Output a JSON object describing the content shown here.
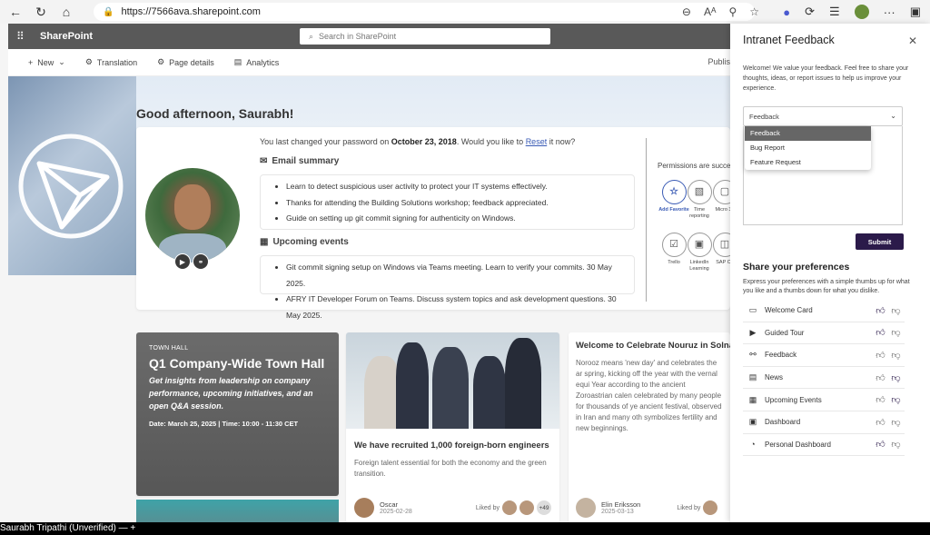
{
  "browser": {
    "url": "https://7566ava.sharepoint.com"
  },
  "sharepoint": {
    "brand": "SharePoint",
    "search_placeholder": "Search in SharePoint",
    "commands": {
      "new": "New",
      "translation": "Translation",
      "page_details": "Page details",
      "analytics": "Analytics",
      "publish": "Publis"
    }
  },
  "welcome": {
    "greeting": "Good afternoon, Saurabh!",
    "pw_prefix": "You last changed your password on ",
    "pw_date": "October 23, 2018",
    "pw_middle": ". Would you like to ",
    "pw_link": "Reset",
    "pw_suffix": " it now?",
    "email_title": "Email summary",
    "emails": [
      "Learn to detect suspicious user activity to protect your IT systems effectively.",
      "Thanks for attending the Building Solutions workshop; feedback appreciated.",
      "Guide on setting up git commit signing for authenticity on Windows."
    ],
    "events_title": "Upcoming events",
    "events": [
      "Git commit signing setup on Windows via Teams meeting. Learn to verify your commits. 30 May 2025.",
      "AFRY IT Developer Forum on Teams. Discuss system topics and ask development questions. 30 May 2025."
    ],
    "permissions_text": "Permissions are succes",
    "apps": [
      {
        "label": "Add Favorite",
        "icon": "star-plus-icon"
      },
      {
        "label": "Time reporting",
        "icon": "timesheet-icon"
      },
      {
        "label": "Micro 36",
        "icon": "microsoft-icon"
      },
      {
        "label": "Trello",
        "icon": "checkbox-icon"
      },
      {
        "label": "LinkedIn Learning",
        "icon": "learning-icon"
      },
      {
        "label": "SAP Co",
        "icon": "sap-icon"
      }
    ]
  },
  "news": {
    "town_hall": {
      "tag": "TOWN HALL",
      "title": "Q1 Company-Wide Town Hall",
      "subtitle": "Get insights from leadership on company performance, upcoming initiatives, and an open Q&A session.",
      "date": "Date: March 25, 2025 | Time: 10:00 - 11:30 CET"
    },
    "recruit": {
      "title": "We have recruited 1,000 foreign-born engineers",
      "desc": "Foreign talent essential for both the economy and the green transition.",
      "author": "Oscar",
      "date": "2025-02-28",
      "liked_by": "Liked by",
      "plus": "+49"
    },
    "nouruz": {
      "title": "Welcome to Celebrate Nouruz in Solna",
      "desc": "Norooz means 'new day' and celebrates the ar spring, kicking off the year with the vernal equi Year according to the ancient Zoroastrian calen celebrated by many people for thousands of ye ancient festival, observed in Iran and many oth symbolizes fertility and new beginnings.",
      "author": "Elin Eriksson",
      "date": "2025-03-13",
      "liked_by": "Liked by"
    }
  },
  "taskbar": {
    "text": "Saurabh Tripathi (Unverified)  —  +"
  },
  "panel": {
    "title": "Intranet Feedback",
    "intro": "Welcome! We value your feedback. Feel free to share your thoughts, ideas, or report issues to help us improve your experience.",
    "select_value": "Feedback",
    "options": [
      "Feedback",
      "Bug Report",
      "Feature Request"
    ],
    "submit": "Submit",
    "pref_title": "Share your preferences",
    "pref_desc": "Express your preferences with a simple thumbs up for what you like and a thumbs down for what you dislike.",
    "prefs": [
      {
        "label": "Welcome Card",
        "icon": "card-icon",
        "up": true,
        "down": false
      },
      {
        "label": "Guided Tour",
        "icon": "play-icon",
        "up": true,
        "down": false
      },
      {
        "label": "Feedback",
        "icon": "feedback-icon",
        "up": false,
        "down": false
      },
      {
        "label": "News",
        "icon": "news-icon",
        "up": false,
        "down": true
      },
      {
        "label": "Upcoming Events",
        "icon": "calendar-icon",
        "up": false,
        "down": true
      },
      {
        "label": "Dashboard",
        "icon": "dashboard-icon",
        "up": false,
        "down": false
      },
      {
        "label": "Personal Dashboard",
        "icon": "gauge-icon",
        "up": true,
        "down": false
      }
    ]
  }
}
